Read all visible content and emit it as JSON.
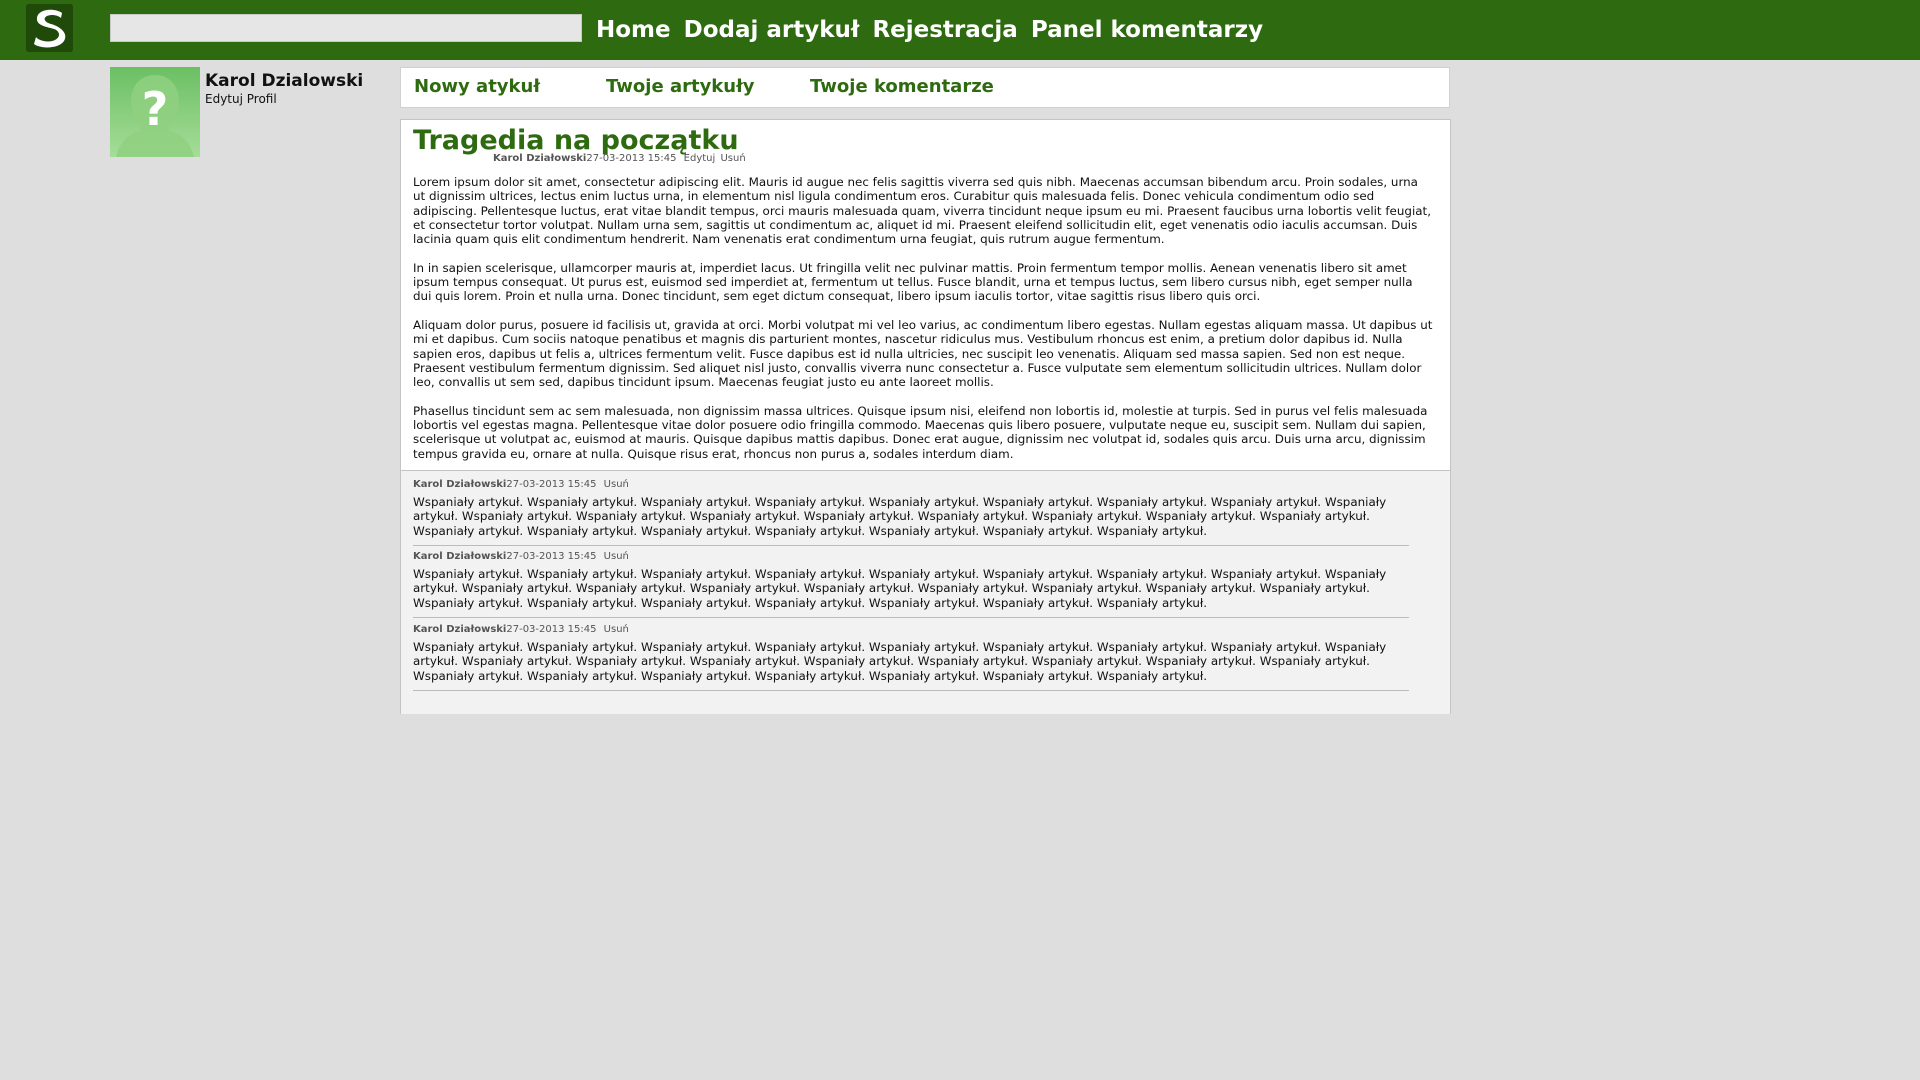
{
  "header": {
    "search_placeholder": "",
    "nav": [
      "Home",
      "Dodaj artykuł",
      "Rejestracja",
      "Panel komentarzy"
    ]
  },
  "profile": {
    "name": "Karol Dzialowski",
    "edit_label": "Edytuj Profil",
    "avatar_icon": "unknown-user-icon"
  },
  "tabs": [
    "Nowy atykuł",
    "Twoje artykuły",
    "Twoje komentarze"
  ],
  "article": {
    "title": "Tragedia na początku",
    "author": "Karol Działowski",
    "date": "27-03-2013 15:45",
    "edit_label": "Edytuj",
    "delete_label": "Usuń",
    "paragraphs": [
      "Lorem ipsum dolor sit amet, consectetur adipiscing elit. Mauris id augue nec felis sagittis viverra sed quis nibh. Maecenas accumsan bibendum arcu. Proin sodales, urna ut dignissim ultrices, lectus enim luctus urna, in elementum nisl ligula condimentum eros. Curabitur quis malesuada felis. Donec vehicula condimentum odio sed adipiscing. Pellentesque luctus, erat vitae blandit tempus, orci mauris malesuada quam, viverra tincidunt neque ipsum eu mi. Praesent faucibus urna lobortis velit feugiat, et consectetur tortor volutpat. Nullam urna sem, sagittis ut condimentum ac, aliquet id mi. Praesent eleifend sollicitudin elit, eget venenatis odio iaculis accumsan. Duis lacinia quam quis elit condimentum hendrerit. Nam venenatis erat condimentum urna feugiat, quis rutrum augue fermentum.",
      "In in sapien scelerisque, ullamcorper mauris at, imperdiet lacus. Ut fringilla velit nec pulvinar mattis. Proin fermentum tempor mollis. Aenean venenatis libero sit amet ipsum tempus consequat. Ut purus est, euismod sed imperdiet at, fermentum ut tellus. Fusce blandit, urna et tempus luctus, sem libero cursus nibh, eget semper nulla dui quis lorem. Proin et nulla urna. Donec tincidunt, sem eget dictum consequat, libero ipsum iaculis tortor, vitae sagittis risus libero quis orci.",
      "Aliquam dolor purus, posuere id facilisis ut, gravida at orci. Morbi volutpat mi vel leo varius, ac condimentum libero egestas. Nullam egestas aliquam massa. Ut dapibus ut mi et dapibus. Cum sociis natoque penatibus et magnis dis parturient montes, nascetur ridiculus mus. Vestibulum rhoncus est enim, a pretium dolor dapibus id. Nulla sapien eros, dapibus ut felis a, ultrices fermentum velit. Fusce dapibus est id nulla ultricies, nec suscipit leo venenatis. Aliquam sed massa sapien. Sed non est neque. Praesent vestibulum fermentum dignissim. Sed aliquet nisl justo, convallis viverra nunc consectetur a. Fusce vulputate sem elementum sollicitudin ultrices. Nullam dolor leo, convallis ut sem sed, dapibus tincidunt ipsum. Maecenas feugiat justo eu ante laoreet mollis.",
      "Phasellus tincidunt sem ac sem malesuada, non dignissim massa ultrices. Quisque ipsum nisi, eleifend non lobortis id, molestie at turpis. Sed in purus vel felis malesuada lobortis vel egestas magna. Pellentesque vitae dolor posuere odio fringilla commodo. Maecenas quis libero posuere, vulputate neque eu, suscipit sem. Nullam dui sapien, scelerisque ut volutpat ac, euismod at mauris. Quisque dapibus mattis dapibus. Donec erat augue, dignissim nec volutpat id, sodales quis arcu. Duis urna arcu, dignissim tempus gravida eu, ornare at nulla. Quisque risus erat, rhoncus non purus a, sodales interdum diam."
    ]
  },
  "comments": [
    {
      "author": "Karol Działowski",
      "date": "27-03-2013 15:45",
      "delete_label": "Usuń",
      "text": "Wspaniały artykuł. Wspaniały artykuł. Wspaniały artykuł. Wspaniały artykuł. Wspaniały artykuł. Wspaniały artykuł. Wspaniały artykuł. Wspaniały artykuł. Wspaniały artykuł. Wspaniały artykuł. Wspaniały artykuł. Wspaniały artykuł. Wspaniały artykuł. Wspaniały artykuł. Wspaniały artykuł. Wspaniały artykuł. Wspaniały artykuł. Wspaniały artykuł. Wspaniały artykuł. Wspaniały artykuł. Wspaniały artykuł. Wspaniały artykuł. Wspaniały artykuł. Wspaniały artykuł."
    },
    {
      "author": "Karol Działowski",
      "date": "27-03-2013 15:45",
      "delete_label": "Usuń",
      "text": "Wspaniały artykuł. Wspaniały artykuł. Wspaniały artykuł. Wspaniały artykuł. Wspaniały artykuł. Wspaniały artykuł. Wspaniały artykuł. Wspaniały artykuł. Wspaniały artykuł. Wspaniały artykuł. Wspaniały artykuł. Wspaniały artykuł. Wspaniały artykuł. Wspaniały artykuł. Wspaniały artykuł. Wspaniały artykuł. Wspaniały artykuł. Wspaniały artykuł. Wspaniały artykuł. Wspaniały artykuł. Wspaniały artykuł. Wspaniały artykuł. Wspaniały artykuł. Wspaniały artykuł."
    },
    {
      "author": "Karol Działowski",
      "date": "27-03-2013 15:45",
      "delete_label": "Usuń",
      "text": "Wspaniały artykuł. Wspaniały artykuł. Wspaniały artykuł. Wspaniały artykuł. Wspaniały artykuł. Wspaniały artykuł. Wspaniały artykuł. Wspaniały artykuł. Wspaniały artykuł. Wspaniały artykuł. Wspaniały artykuł. Wspaniały artykuł. Wspaniały artykuł. Wspaniały artykuł. Wspaniały artykuł. Wspaniały artykuł. Wspaniały artykuł. Wspaniały artykuł. Wspaniały artykuł. Wspaniały artykuł. Wspaniały artykuł. Wspaniały artykuł. Wspaniały artykuł. Wspaniały artykuł."
    }
  ],
  "colors": {
    "brand_green": "#2e6a0f",
    "page_background": "#dedede",
    "comments_background": "#f2f2f2"
  }
}
